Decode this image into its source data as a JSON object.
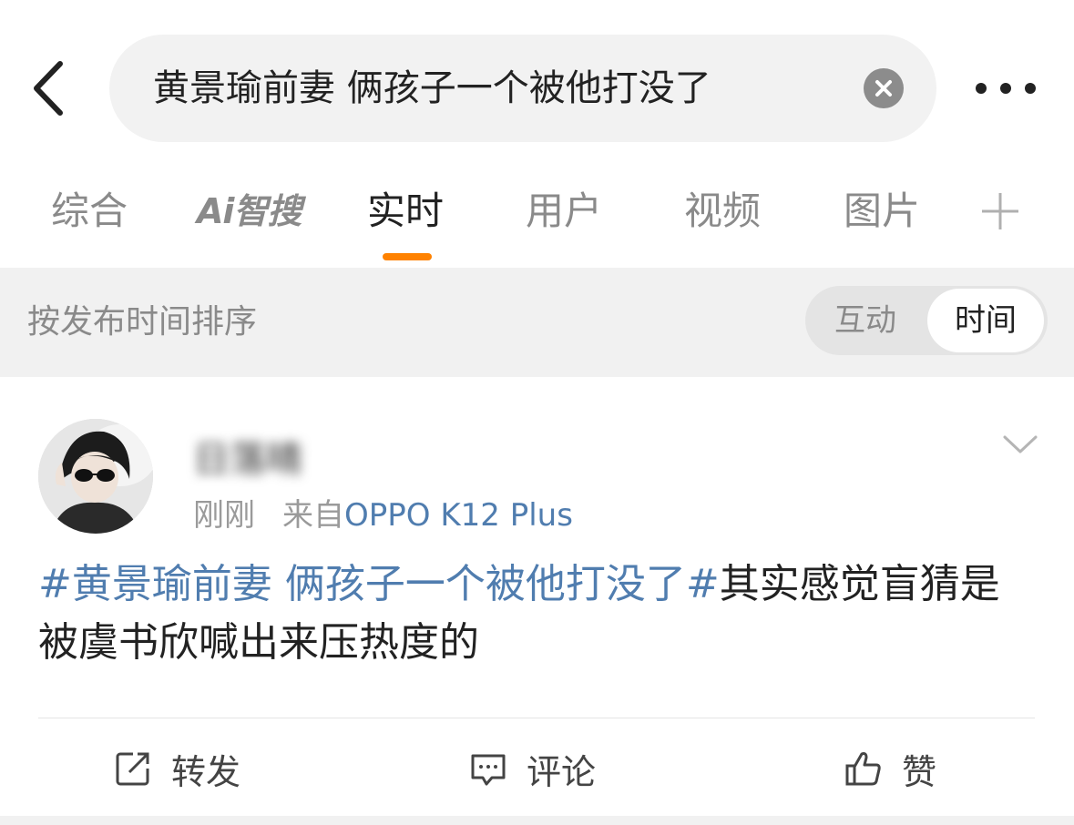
{
  "search": {
    "query": "黄景瑜前妻 俩孩子一个被他打没了"
  },
  "tabs": [
    {
      "label": "综合"
    },
    {
      "label": "Ai智搜"
    },
    {
      "label": "实时"
    },
    {
      "label": "用户"
    },
    {
      "label": "视频"
    },
    {
      "label": "图片"
    }
  ],
  "active_tab": "实时",
  "sort": {
    "label": "按发布时间排序",
    "options": [
      "互动",
      "时间"
    ],
    "selected": "时间"
  },
  "post": {
    "username": "日落晴",
    "time": "刚刚",
    "source_prefix": "来自",
    "source_device": "OPPO K12 Plus",
    "hashtag": "#黄景瑜前妻 俩孩子一个被他打没了#",
    "body": "其实感觉盲猜是被虞书欣喊出来压热度的",
    "actions": {
      "repost": "转发",
      "comment": "评论",
      "like": "赞"
    }
  },
  "colors": {
    "accent": "#ff8200",
    "link": "#507daf"
  }
}
